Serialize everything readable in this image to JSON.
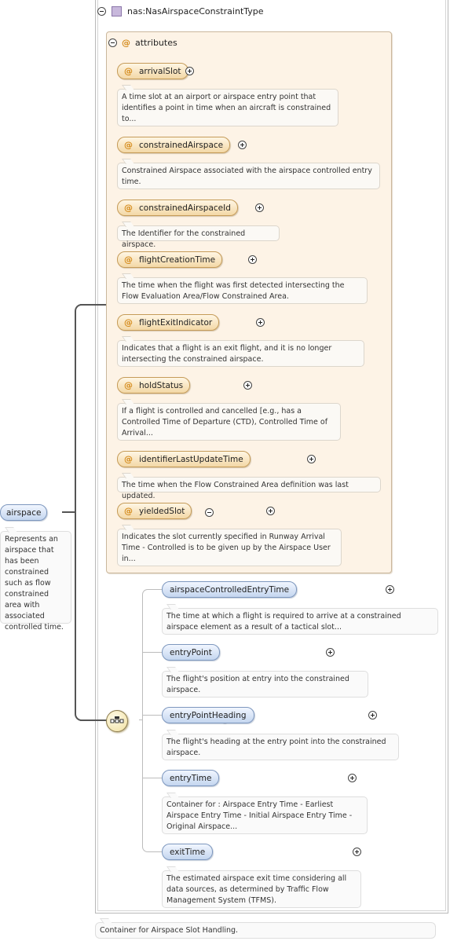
{
  "type_name": "nas:NasAirspaceConstraintType",
  "attributes_label": "attributes",
  "attributes": [
    {
      "name": "arrivalSlot",
      "desc": "A time slot at an airport or airspace entry point that identifies a point in time when an aircraft is constrained to..."
    },
    {
      "name": "constrainedAirspace",
      "desc": "Constrained Airspace associated with the airspace controlled entry time."
    },
    {
      "name": "constrainedAirspaceId",
      "desc": "The Identifier for the constrained airspace."
    },
    {
      "name": "flightCreationTime",
      "desc": "The time when the flight was first detected intersecting the Flow Evaluation Area/Flow Constrained Area."
    },
    {
      "name": "flightExitIndicator",
      "desc": "Indicates that a flight is an exit flight, and it is no longer intersecting the constrained airspace."
    },
    {
      "name": "holdStatus",
      "desc": "If a flight is controlled and cancelled [e.g., has a Controlled Time of Departure (CTD), Controlled Time of Arrival..."
    },
    {
      "name": "identifierLastUpdateTime",
      "desc": "The time when the Flow Constrained Area definition was last updated."
    },
    {
      "name": "yieldedSlot",
      "desc": "Indicates the slot currently specified in Runway Arrival Time - Controlled is to be given up by the Airspace User in..."
    }
  ],
  "elements": [
    {
      "name": "airspaceControlledEntryTime",
      "desc": "The time at which a flight is required to arrive at a constrained airspace element as a result of a tactical slot..."
    },
    {
      "name": "entryPoint",
      "desc": "The flight's position at entry into the constrained airspace."
    },
    {
      "name": "entryPointHeading",
      "desc": "The flight's heading at the entry point into the constrained airspace."
    },
    {
      "name": "entryTime",
      "desc": "Container for : Airspace Entry Time - Earliest Airspace Entry Time - Initial Airspace Entry Time - Original Airspace..."
    },
    {
      "name": "exitTime",
      "desc": "The estimated airspace exit time considering all data sources, as determined by Traffic Flow Management System (TFMS)."
    }
  ],
  "root": {
    "name": "airspace",
    "desc": "Represents an airspace that has been constrained such as flow constrained area with associated controlled time."
  },
  "type_desc": "Container for Airspace Slot Handling."
}
